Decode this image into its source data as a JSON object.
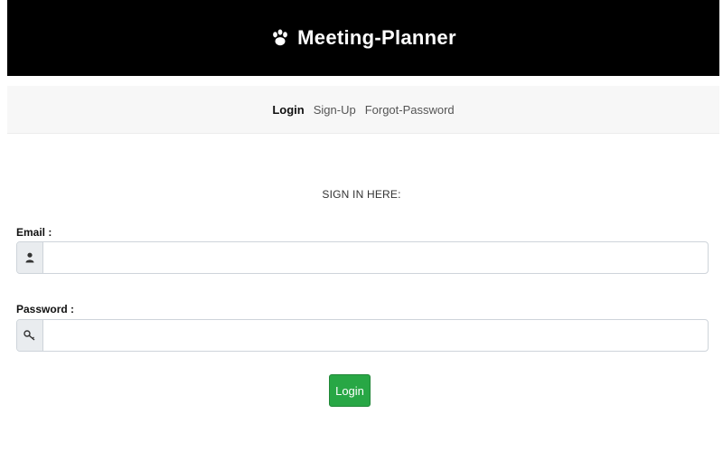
{
  "header": {
    "brand_icon": "paw-icon",
    "title": "Meeting-Planner",
    "background": "#000000"
  },
  "nav": {
    "items": [
      {
        "label": "Login",
        "active": true
      },
      {
        "label": "Sign-Up",
        "active": false
      },
      {
        "label": "Forgot-Password",
        "active": false
      }
    ]
  },
  "form": {
    "heading": "SIGN IN HERE:",
    "email": {
      "label": "Email :",
      "icon": "user-icon",
      "value": "",
      "placeholder": ""
    },
    "password": {
      "label": "Password :",
      "icon": "key-icon",
      "value": "",
      "placeholder": ""
    },
    "submit_label": "Login",
    "submit_color": "#28a745"
  }
}
